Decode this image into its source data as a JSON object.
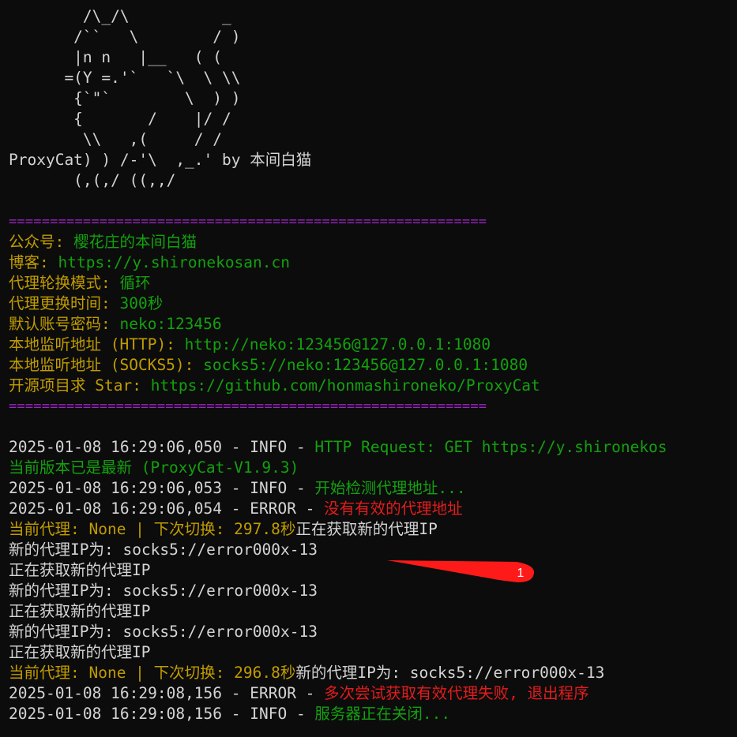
{
  "ascii_art": [
    "        /\\_/\\          _",
    "       /``   \\        / )",
    "       |n n   |__   ( (",
    "      =(Y =.'`   `\\  \\ \\\\",
    "       {`\"`        \\  ) )",
    "       {       /    |/ /",
    "        \\\\   ,(     / /",
    "ProxyCat) ) /-'\\  ,_.' by 本间白猫",
    "       (,(,/ ((,,/"
  ],
  "separator": "==========================================================",
  "info": {
    "public_account": {
      "label": "公众号:",
      "value": "樱花庄的本间白猫"
    },
    "blog": {
      "label": "博客:",
      "value": "https://y.shironekosan.cn"
    },
    "rotation_mode": {
      "label": "代理轮换模式:",
      "value": "循环"
    },
    "rotation_interval": {
      "label": "代理更换时间:",
      "value": "300秒"
    },
    "default_credentials": {
      "label": "默认账号密码:",
      "value": "neko:123456"
    },
    "http_listen": {
      "label": "本地监听地址 (HTTP):",
      "value": "http://neko:123456@127.0.0.1:1080"
    },
    "socks_listen": {
      "label": "本地监听地址 (SOCKS5):",
      "value": "socks5://neko:123456@127.0.0.1:1080"
    },
    "star": {
      "label": "开源项目求 Star:",
      "value": "https://github.com/honmashironeko/ProxyCat"
    }
  },
  "log": {
    "l1": {
      "prefix": "2025-01-08 16:29:06,050 - INFO - ",
      "message": "HTTP Request: GET https://y.shironekos"
    },
    "l2": {
      "message": "当前版本已是最新 (ProxyCat-V1.9.3)"
    },
    "l3": {
      "prefix": "2025-01-08 16:29:06,053 - INFO - ",
      "message": "开始检测代理地址..."
    },
    "l4": {
      "prefix": "2025-01-08 16:29:06,054 - ERROR - ",
      "message": "没有有效的代理地址"
    },
    "l5": {
      "status": "当前代理: None | 下次切换: 297.8秒",
      "tail": "正在获取新的代理IP"
    },
    "l6": {
      "text": "新的代理IP为: socks5://error000x-13"
    },
    "l7": {
      "text": "正在获取新的代理IP"
    },
    "l8": {
      "text": "新的代理IP为: socks5://error000x-13"
    },
    "l9": {
      "text": "正在获取新的代理IP"
    },
    "l10": {
      "text": "新的代理IP为: socks5://error000x-13"
    },
    "l11": {
      "text": "正在获取新的代理IP"
    },
    "l12": {
      "status": "当前代理: None | 下次切换: 296.8秒",
      "tail": "新的代理IP为: socks5://error000x-13"
    },
    "l13": {
      "prefix": "2025-01-08 16:29:08,156 - ERROR - ",
      "message": "多次尝试获取有效代理失败, 退出程序"
    },
    "l14": {
      "prefix": "2025-01-08 16:29:08,156 - INFO - ",
      "message": "服务器正在关闭..."
    }
  },
  "annotation": {
    "number": "1",
    "color": "#ff1a1a"
  },
  "colors": {
    "background": "#0c0c0c",
    "text": "#d4d4d4",
    "label": "#c19c00",
    "value": "#13a10e",
    "error": "#e31c1c",
    "separator": "#9b26c4"
  }
}
